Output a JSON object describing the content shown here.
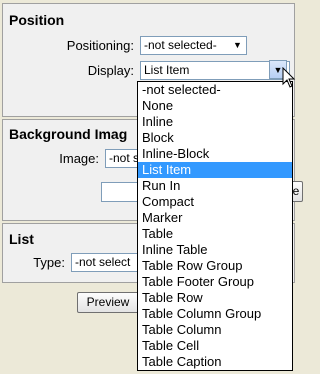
{
  "position": {
    "title": "Position",
    "positioning_label": "Positioning:",
    "positioning_value": "-not selected-",
    "display_label": "Display:",
    "display_value": "List Item"
  },
  "background": {
    "title": "Background Imag",
    "image_label": "Image:",
    "image_value": "-not s",
    "input_value": "",
    "button_label": "se"
  },
  "list": {
    "title": "List",
    "type_label": "Type:",
    "type_value": "-not select"
  },
  "preview_button": "Preview",
  "dropdown_options": [
    "-not selected-",
    "None",
    "Inline",
    "Block",
    "Inline-Block",
    "List Item",
    "Run In",
    "Compact",
    "Marker",
    "Table",
    "Inline Table",
    "Table Row Group",
    "Table Footer Group",
    "Table Row",
    "Table Column Group",
    "Table Column",
    "Table Cell",
    "Table Caption"
  ],
  "selected_option": "List Item",
  "colors": {
    "highlight": "#3399ff",
    "background": "#ece9d8"
  }
}
